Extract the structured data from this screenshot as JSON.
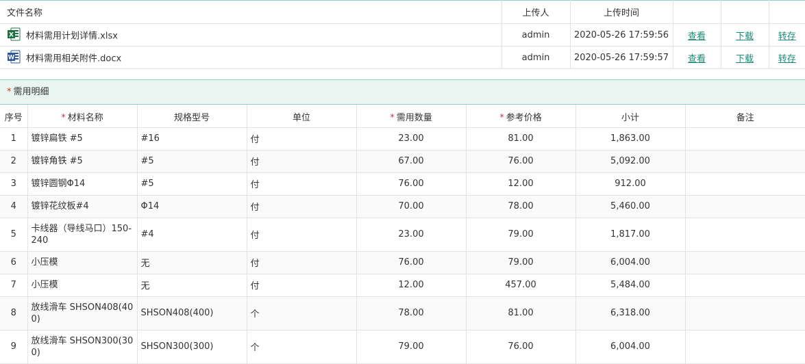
{
  "files": {
    "headers": {
      "name": "文件名称",
      "uploader": "上传人",
      "time": "上传时间"
    },
    "rows": [
      {
        "icon": "excel-file-icon",
        "name": "材料需用计划详情.xlsx",
        "uploader": "admin",
        "time": "2020-05-26 17:59:56",
        "view": "查看",
        "download": "下载",
        "transfer": "转存"
      },
      {
        "icon": "word-file-icon",
        "name": "材料需用相关附件.docx",
        "uploader": "admin",
        "time": "2020-05-26 17:59:57",
        "view": "查看",
        "download": "下载",
        "transfer": "转存"
      }
    ]
  },
  "section": {
    "required_mark": "*",
    "title": "需用明细"
  },
  "detail": {
    "headers": {
      "seq": "序号",
      "name": "材料名称",
      "spec": "规格型号",
      "unit": "单位",
      "qty": "需用数量",
      "price": "参考价格",
      "subtotal": "小计",
      "remark": "备注"
    },
    "required_mark": "*",
    "rows": [
      {
        "seq": "1",
        "name": "镀锌扁铁 #5",
        "spec": "#16",
        "unit": "付",
        "qty": "23.00",
        "price": "81.00",
        "subtotal": "1,863.00",
        "remark": ""
      },
      {
        "seq": "2",
        "name": "镀锌角铁 #5",
        "spec": "#5",
        "unit": "付",
        "qty": "67.00",
        "price": "76.00",
        "subtotal": "5,092.00",
        "remark": ""
      },
      {
        "seq": "3",
        "name": "镀锌圆钢Φ14",
        "spec": "#5",
        "unit": "付",
        "qty": "76.00",
        "price": "12.00",
        "subtotal": "912.00",
        "remark": ""
      },
      {
        "seq": "4",
        "name": "镀锌花纹板#4",
        "spec": "Φ14",
        "unit": "付",
        "qty": "70.00",
        "price": "78.00",
        "subtotal": "5,460.00",
        "remark": ""
      },
      {
        "seq": "5",
        "name": "卡线器（导线马口）150-240",
        "spec": "#4",
        "unit": "付",
        "qty": "23.00",
        "price": "79.00",
        "subtotal": "1,817.00",
        "remark": ""
      },
      {
        "seq": "6",
        "name": "小压模",
        "spec": "无",
        "unit": "付",
        "qty": "76.00",
        "price": "79.00",
        "subtotal": "6,004.00",
        "remark": ""
      },
      {
        "seq": "7",
        "name": "小压模",
        "spec": "无",
        "unit": "付",
        "qty": "12.00",
        "price": "457.00",
        "subtotal": "5,484.00",
        "remark": ""
      },
      {
        "seq": "8",
        "name": "放线滑车 SHSON408(400)",
        "spec": "SHSON408(400)",
        "unit": "个",
        "qty": "78.00",
        "price": "81.00",
        "subtotal": "6,318.00",
        "remark": ""
      },
      {
        "seq": "9",
        "name": "放线滑车 SHSON300(300)",
        "spec": "SHSON300(300)",
        "unit": "个",
        "qty": "79.00",
        "price": "76.00",
        "subtotal": "6,004.00",
        "remark": ""
      }
    ]
  },
  "colors": {
    "accent": "#1a8c77",
    "section_bg": "#e8f5f1",
    "border_accent": "#8fcfc5",
    "required": "#e03030",
    "excel": "#1d7044",
    "word": "#2b579a"
  }
}
